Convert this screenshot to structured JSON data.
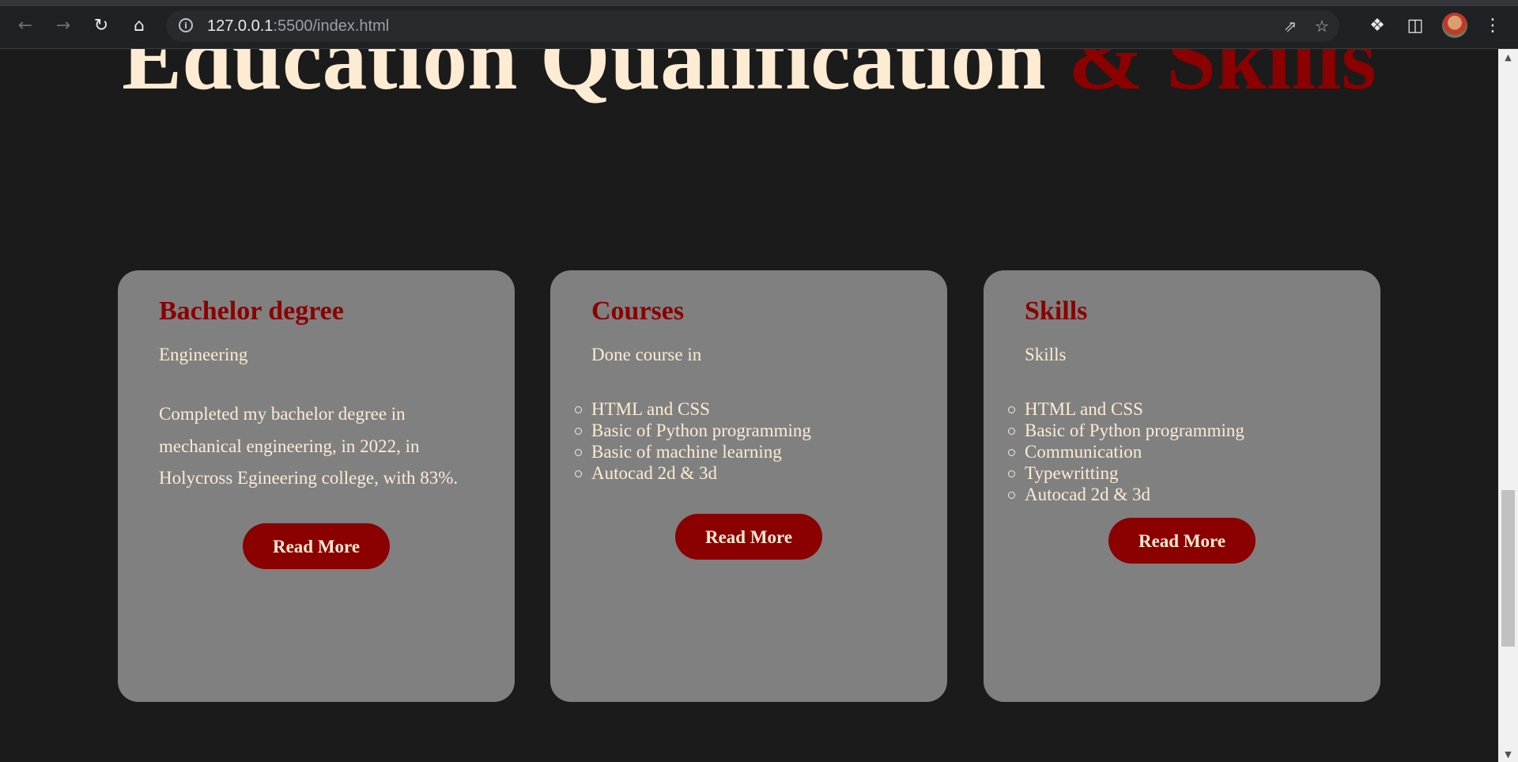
{
  "browser": {
    "url_host": "127.0.0.1",
    "url_rest": ":5500/index.html",
    "icons": {
      "back": "arrow-left-icon",
      "forward": "arrow-right-icon",
      "reload": "reload-icon",
      "home": "home-icon",
      "info": "info-icon",
      "share": "share-icon",
      "bookmark": "star-icon",
      "extensions": "puzzle-icon",
      "side_panel": "side-panel-icon",
      "menu": "kebab-menu-icon"
    }
  },
  "section": {
    "heading_main": "Education Qualification ",
    "heading_accent": "& Skills"
  },
  "cards": [
    {
      "title": "Bachelor degree",
      "subtitle": "Engineering",
      "description": "Completed my bachelor degree in mechanical engineering, in 2022, in Holycross Egineering college, with 83%.",
      "button": "Read More"
    },
    {
      "title": "Courses",
      "subtitle": "Done course in",
      "items": [
        "HTML and CSS",
        "Basic of Python programming",
        "Basic of machine learning",
        "Autocad 2d & 3d"
      ],
      "button": "Read More"
    },
    {
      "title": "Skills",
      "subtitle": "Skills",
      "items": [
        "HTML and CSS",
        "Basic of Python programming",
        "Communication",
        "Typewritting",
        "Autocad 2d & 3d"
      ],
      "button": "Read More"
    }
  ],
  "colors": {
    "page_bg": "#1b1b1b",
    "accent": "#8b0000",
    "text_light": "#fdebd3",
    "card_bg": "#808080"
  }
}
